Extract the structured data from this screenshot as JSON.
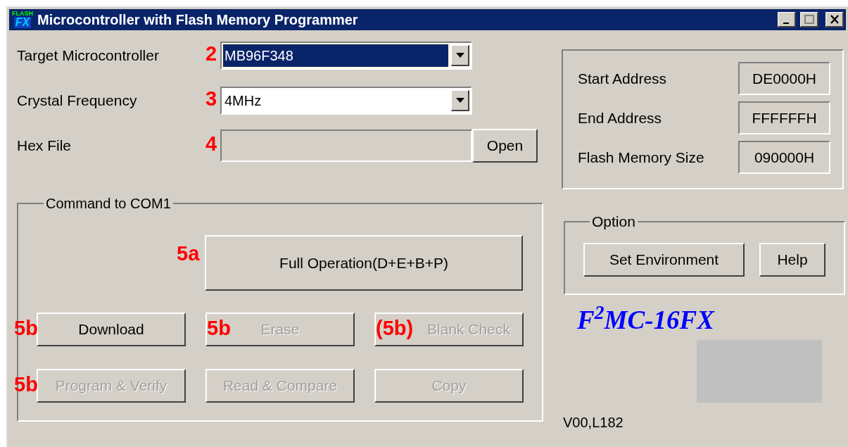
{
  "window": {
    "title": "Microcontroller with Flash Memory Programmer",
    "logo_top": "FLASH",
    "logo_bottom": "FX"
  },
  "settings": [
    {
      "kind": "combo",
      "label": "Target Microcontroller",
      "value": "MB96F348",
      "selected": true,
      "annotation": "2"
    },
    {
      "kind": "combo",
      "label": "Crystal Frequency",
      "value": "4MHz",
      "selected": false,
      "annotation": "3"
    },
    {
      "kind": "file",
      "label": "Hex File",
      "disabled": true,
      "button": "Open",
      "annotation": "4"
    }
  ],
  "command_group": {
    "title": "Command to COM1",
    "full_operation": {
      "label": "Full Operation(D+E+B+P)",
      "disabled": false,
      "annotation": "5a"
    },
    "buttons": [
      {
        "label": "Download",
        "disabled": false,
        "annotation": "5b"
      },
      {
        "label": "Erase",
        "disabled": true,
        "annotation": "5b"
      },
      {
        "label": "Blank Check",
        "disabled": true,
        "annotation": "(5b)"
      },
      {
        "label": "Program & Verify",
        "disabled": true,
        "annotation": "5b"
      },
      {
        "label": "Read & Compare",
        "disabled": true
      },
      {
        "label": "Copy",
        "disabled": true
      }
    ]
  },
  "info": [
    {
      "label": "Start Address",
      "value": "DE0000H"
    },
    {
      "label": "End Address",
      "value": "FFFFFFH"
    },
    {
      "label": "Flash Memory Size",
      "value": "090000H"
    }
  ],
  "option_group": {
    "title": "Option",
    "buttons": [
      "Set Environment",
      "Help"
    ]
  },
  "product_logo": "F$^{2}$MC-16FX",
  "version": "V00,L182"
}
